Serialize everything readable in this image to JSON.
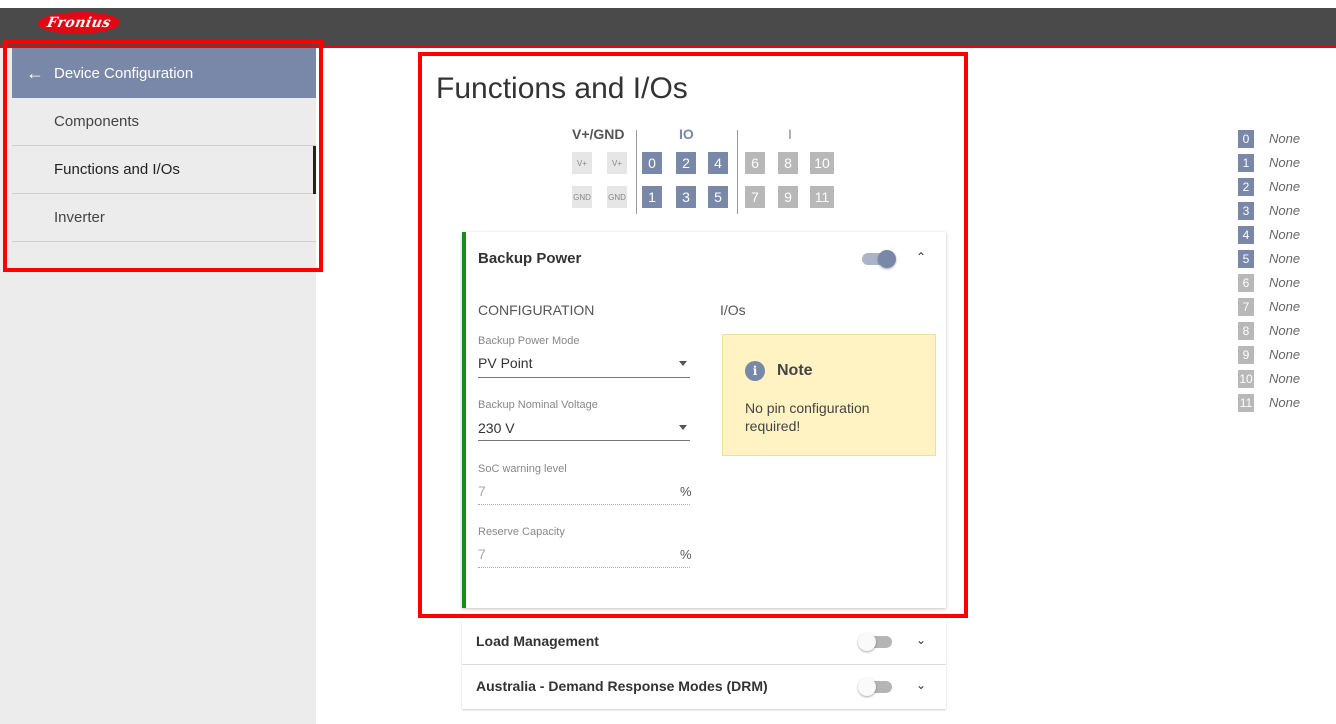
{
  "header": {
    "logo_text": "Fronius",
    "accent": "#e30613",
    "bar_color": "#4a4a4a"
  },
  "sidebar": {
    "title": "Device Configuration",
    "back_icon": "arrow-left-icon",
    "items": [
      {
        "label": "Components"
      },
      {
        "label": "Functions and I/Os"
      },
      {
        "label": "Inverter"
      }
    ]
  },
  "main": {
    "title": "Functions and I/Os",
    "pins": {
      "vgnd_label": "V+/GND",
      "io_label": "IO",
      "i_label": "I",
      "v_plus": "V+",
      "gnd": "GND",
      "io_top": [
        "0",
        "2",
        "4"
      ],
      "io_bottom": [
        "1",
        "3",
        "5"
      ],
      "i_top": [
        "6",
        "8",
        "10"
      ],
      "i_bottom": [
        "7",
        "9",
        "11"
      ]
    },
    "backup": {
      "title": "Backup Power",
      "toggle": "on",
      "config_heading": "CONFIGURATION",
      "ios_heading": "I/Os",
      "mode_label": "Backup Power Mode",
      "mode_value": "PV Point",
      "voltage_label": "Backup Nominal Voltage",
      "voltage_value": "230 V",
      "soc_label": "SoC warning level",
      "soc_value": "7",
      "soc_unit": "%",
      "reserve_label": "Reserve Capacity",
      "reserve_value": "7",
      "reserve_unit": "%",
      "note_icon": "info-icon",
      "note_title": "Note",
      "note_text": "No pin configuration required!"
    },
    "load_management": {
      "title": "Load Management",
      "toggle": "off"
    },
    "drm": {
      "title": "Australia - Demand Response Modes (DRM)",
      "toggle": "off"
    }
  },
  "legend": [
    {
      "num": "0",
      "text": "None"
    },
    {
      "num": "1",
      "text": "None"
    },
    {
      "num": "2",
      "text": "None"
    },
    {
      "num": "3",
      "text": "None"
    },
    {
      "num": "4",
      "text": "None"
    },
    {
      "num": "5",
      "text": "None"
    },
    {
      "num": "6",
      "text": "None"
    },
    {
      "num": "7",
      "text": "None"
    },
    {
      "num": "8",
      "text": "None"
    },
    {
      "num": "9",
      "text": "None"
    },
    {
      "num": "10",
      "text": "None"
    },
    {
      "num": "11",
      "text": "None"
    }
  ],
  "colors": {
    "io_pin": "#7987a8",
    "i_pin": "#b8b8b8",
    "highlight_box": "#ff0000",
    "card_accent": "#1a8c1a",
    "note_bg": "#fff3c4"
  }
}
